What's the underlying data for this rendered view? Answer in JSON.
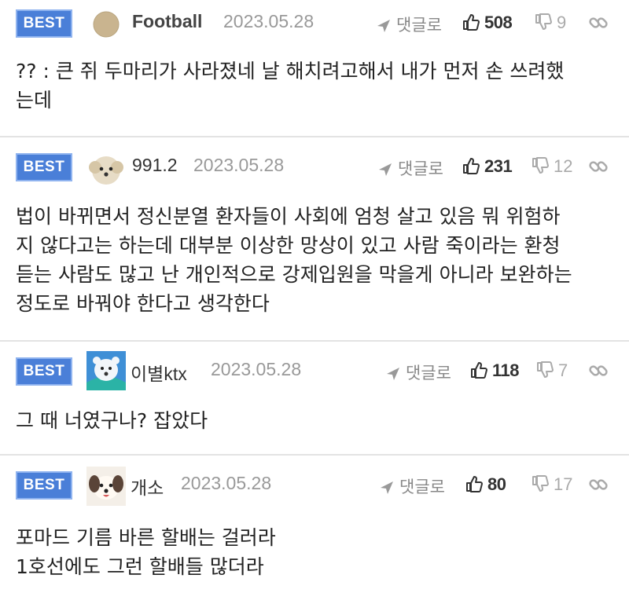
{
  "comments": [
    {
      "badge": "BEST",
      "nickname": "Football",
      "date": "2023.05.28",
      "reply_label": "댓글로",
      "upvotes": "508",
      "downvotes": "9",
      "avatar": "circle-avatar",
      "text": "?? : 큰 쥐 두마리가 사라졌네 날 해치려고해서 내가 먼저 손 쓰려했\n는데"
    },
    {
      "badge": "BEST",
      "nickname": "991.2",
      "date": "2023.05.28",
      "reply_label": "댓글로",
      "upvotes": "231",
      "downvotes": "12",
      "avatar": "puppy-avatar",
      "text": "법이 바뀌면서 정신분열 환자들이 사회에 엄청 살고 있음 뭐 위험하\n지 않다고는 하는데 대부분 이상한 망상이 있고 사람 죽이라는 환청\n듣는 사람도 많고 난 개인적으로 강제입원을 막을게 아니라 보완하는\n정도로 바꿔야 한다고 생각한다"
    },
    {
      "badge": "BEST",
      "nickname": "이별ktx",
      "date": "2023.05.28",
      "reply_label": "댓글로",
      "upvotes": "118",
      "downvotes": "7",
      "avatar": "polar-bear-avatar",
      "text": "그 때 너였구나? 잡았다"
    },
    {
      "badge": "BEST",
      "nickname": "개소",
      "date": "2023.05.28",
      "reply_label": "댓글로",
      "upvotes": "80",
      "downvotes": "17",
      "avatar": "dog-avatar",
      "text": "포마드 기름 바른 할배는 걸러라\n1호선에도 그런 할배들 많더라"
    }
  ],
  "colors": {
    "badge": "#4a7fd8",
    "divider": "#e3e3e3",
    "muted": "#999999"
  }
}
